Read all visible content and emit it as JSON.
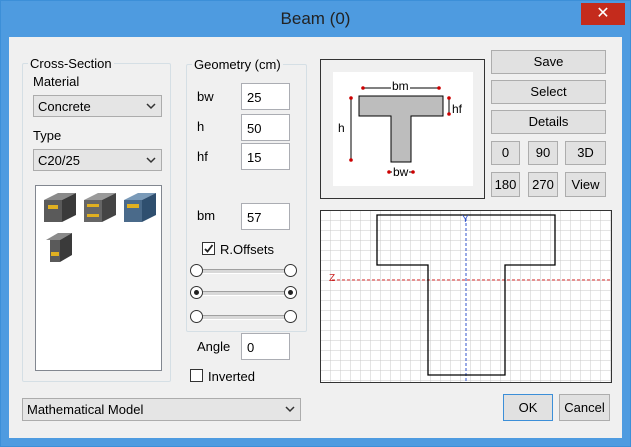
{
  "window": {
    "title": "Beam (0)",
    "close_label": "✕"
  },
  "cross_section": {
    "group_label": "Cross-Section",
    "material_label": "Material",
    "material_value": "Concrete",
    "type_label": "Type",
    "type_value": "C20/25"
  },
  "geometry": {
    "group_label": "Geometry (cm)",
    "fields": [
      {
        "label": "bw",
        "value": "25"
      },
      {
        "label": "h",
        "value": "50"
      },
      {
        "label": "hf",
        "value": "15"
      },
      {
        "label": "bm",
        "value": "57"
      }
    ],
    "roffsets_label": "R.Offsets",
    "roffsets_checked": true,
    "angle_label": "Angle",
    "angle_value": "0",
    "inverted_label": "Inverted",
    "inverted_checked": false
  },
  "preview": {
    "bm": "bm",
    "hf": "hf",
    "h": "h",
    "bw": "bw"
  },
  "canvas": {
    "y_axis": "Y",
    "z_axis": "Z"
  },
  "buttons": {
    "save": "Save",
    "select": "Select",
    "details": "Details",
    "rot0": "0",
    "rot90": "90",
    "view3d": "3D",
    "rot180": "180",
    "rot270": "270",
    "view": "View",
    "ok": "OK",
    "cancel": "Cancel"
  },
  "model_select": {
    "value": "Mathematical Model"
  },
  "colors": {
    "title_bar": "#4e9be0",
    "close": "#c42b1c",
    "dialog": "#f0f0f0",
    "axis_y": "#3355cc",
    "axis_z": "#cc2222"
  }
}
